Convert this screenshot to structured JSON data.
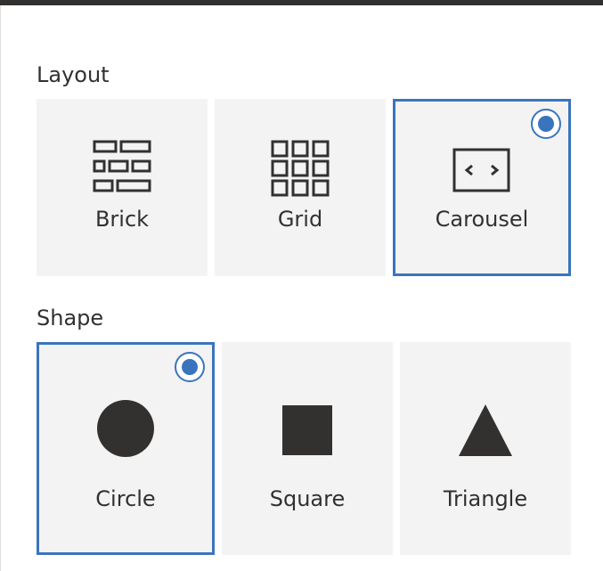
{
  "layout": {
    "label": "Layout",
    "options": [
      {
        "label": "Brick",
        "icon": "brick-layout-icon",
        "selected": false
      },
      {
        "label": "Grid",
        "icon": "grid-layout-icon",
        "selected": false
      },
      {
        "label": "Carousel",
        "icon": "carousel-layout-icon",
        "selected": true
      }
    ]
  },
  "shape": {
    "label": "Shape",
    "options": [
      {
        "label": "Circle",
        "icon": "circle-shape-icon",
        "selected": true
      },
      {
        "label": "Square",
        "icon": "square-shape-icon",
        "selected": false
      },
      {
        "label": "Triangle",
        "icon": "triangle-shape-icon",
        "selected": false
      }
    ]
  },
  "colors": {
    "accent": "#3a74bd",
    "tile_background": "#f3f3f3",
    "icon": "#323130"
  }
}
